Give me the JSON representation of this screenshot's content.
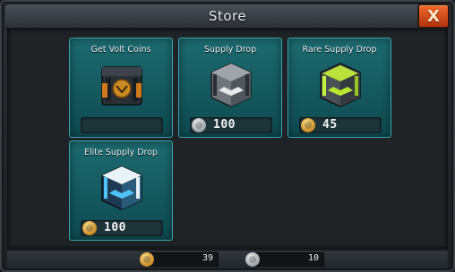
{
  "window": {
    "title": "Store",
    "close_label": "X"
  },
  "items": [
    {
      "title": "Get Volt Coins",
      "price": "",
      "currency": ""
    },
    {
      "title": "Supply Drop",
      "price": "100",
      "currency": "silver"
    },
    {
      "title": "Rare Supply Drop",
      "price": "45",
      "currency": "gold"
    },
    {
      "title": "Elite Supply Drop",
      "price": "100",
      "currency": "gold"
    }
  ],
  "wallet": {
    "gold": "39",
    "silver": "10"
  },
  "colors": {
    "card": "#1c6b70",
    "card_border": "#3aa5ab",
    "close": "#e0541d",
    "rare_accent": "#c8f23a",
    "elite_accent": "#4fc3f7"
  }
}
